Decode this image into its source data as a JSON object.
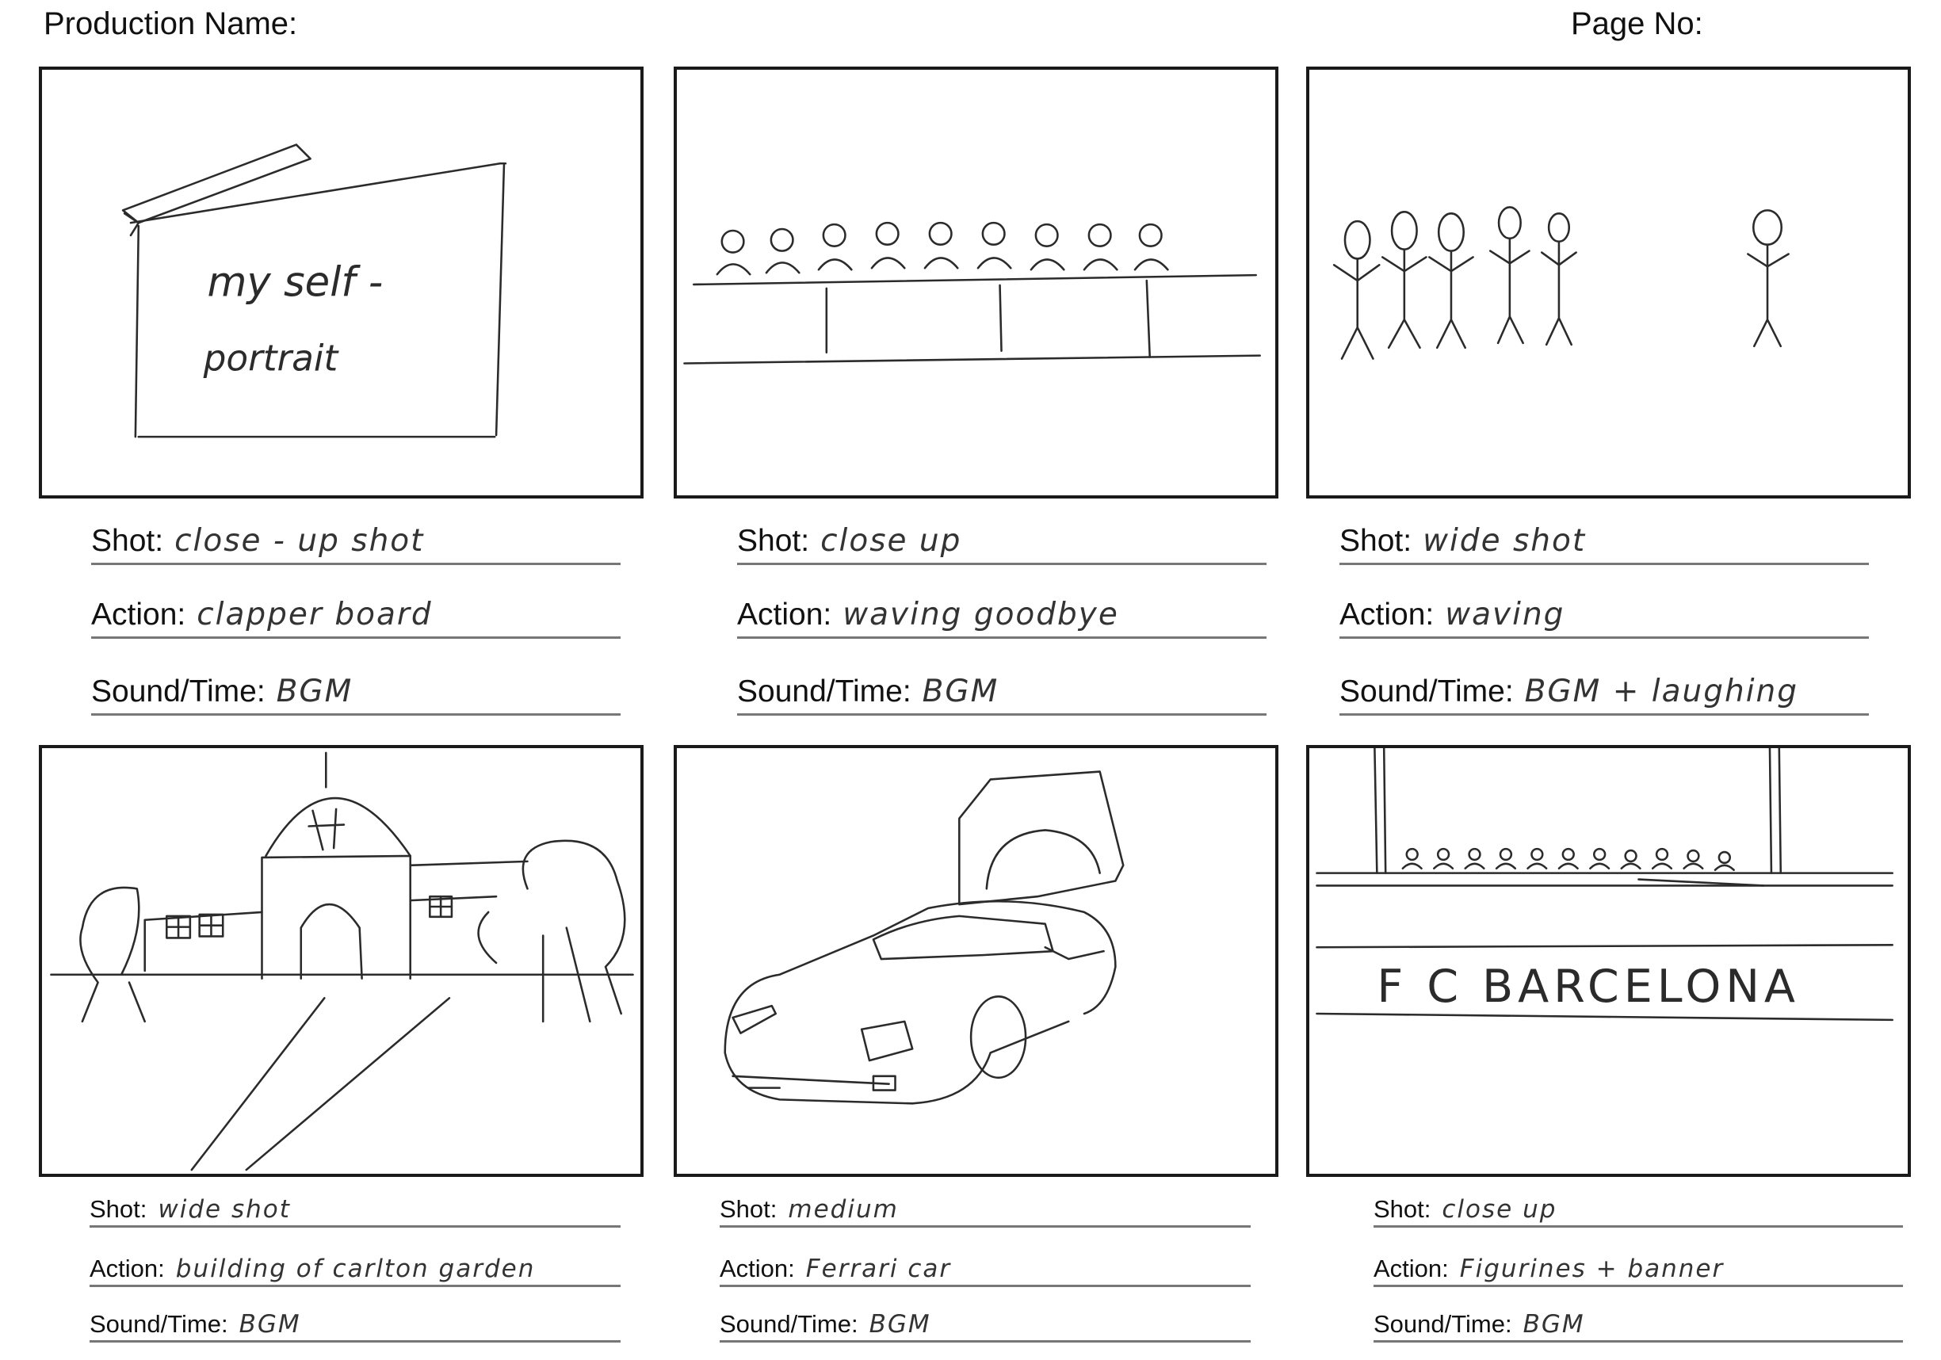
{
  "header": {
    "production_label": "Production Name:",
    "page_label": "Page No:"
  },
  "labels": {
    "shot": "Shot:",
    "action": "Action:",
    "sound": "Sound/Time:"
  },
  "frames": [
    {
      "shot": "close - up shot",
      "action": "clapper board",
      "sound": "BGM",
      "sketch_text": [
        "my self -",
        "portrait"
      ]
    },
    {
      "shot": "close up",
      "action": "waving goodbye",
      "sound": "BGM"
    },
    {
      "shot": "wide shot",
      "action": "waving",
      "sound": "BGM + laughing"
    },
    {
      "shot": "wide shot",
      "action": "building of carlton garden",
      "sound": "BGM"
    },
    {
      "shot": "medium",
      "action": "Ferrari car",
      "sound": "BGM"
    },
    {
      "shot": "close up",
      "action": "Figurines + banner",
      "sound": "BGM",
      "sketch_text": [
        "F C  BARCELONA"
      ]
    }
  ]
}
